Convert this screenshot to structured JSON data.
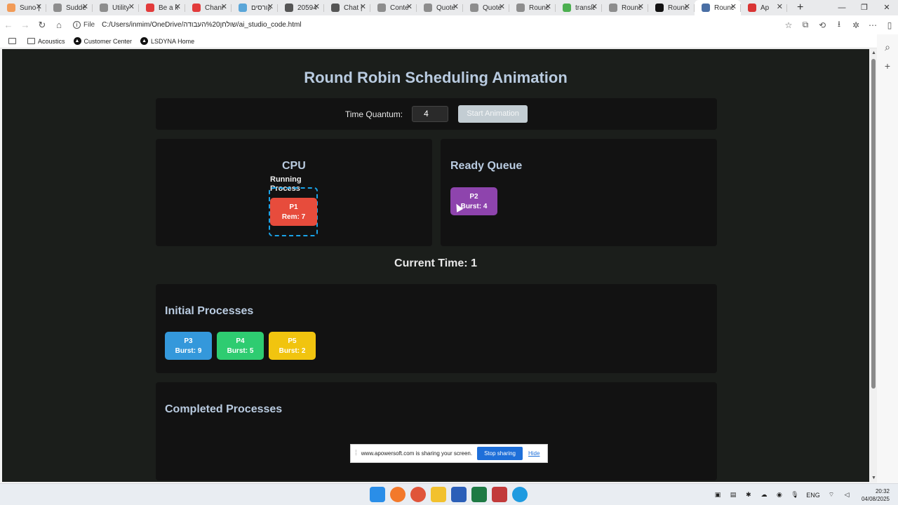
{
  "browser": {
    "tabs": [
      {
        "label": "Suno |",
        "color": "#f29b57"
      },
      {
        "label": "Sudden",
        "color": "#8d8d8d"
      },
      {
        "label": "Utility",
        "color": "#8d8d8d"
      },
      {
        "label": "Be a lo",
        "color": "#e23b3b"
      },
      {
        "label": "Chann",
        "color": "#e23b3b"
      },
      {
        "label": "קורסים",
        "color": "#5aa6d8"
      },
      {
        "label": "20594",
        "color": "#555555"
      },
      {
        "label": "Chat |",
        "color": "#555555"
      },
      {
        "label": "Conte",
        "color": "#8d8d8d"
      },
      {
        "label": "Quote",
        "color": "#8d8d8d"
      },
      {
        "label": "Quote",
        "color": "#8d8d8d"
      },
      {
        "label": "Round",
        "color": "#8d8d8d"
      },
      {
        "label": "transla",
        "color": "#4caf50"
      },
      {
        "label": "Round",
        "color": "#8d8d8d"
      },
      {
        "label": "Round",
        "color": "#111111"
      },
      {
        "label": "Round",
        "color": "#4a6fa5"
      },
      {
        "label": "Ap",
        "color": "#d93434"
      }
    ],
    "url_prefix": "File",
    "url": "C:/Users/inmim/OneDrive/שולחן%20העבודה/ai_studio_code.html",
    "bookmarks": [
      "Acoustics",
      "Customer Center",
      "LSDYNA Home"
    ]
  },
  "page": {
    "title": "Round Robin Scheduling Animation",
    "quantum_label": "Time Quantum:",
    "quantum_value": "4",
    "start_button": "Start Animation",
    "cpu_title": "CPU",
    "running_label": "Running Process",
    "running_process": {
      "name": "P1",
      "rem": "Rem: 7",
      "color": "#e74c3c"
    },
    "queue_title": "Ready Queue",
    "queue": [
      {
        "name": "P2",
        "burst": "Burst: 4",
        "color": "#8e44ad"
      }
    ],
    "current_time": "Current Time: 1",
    "initial_title": "Initial Processes",
    "initial": [
      {
        "name": "P3",
        "burst": "Burst: 9",
        "color": "#3498db"
      },
      {
        "name": "P4",
        "burst": "Burst: 5",
        "color": "#2ecc71"
      },
      {
        "name": "P5",
        "burst": "Burst: 2",
        "color": "#f1c40f"
      }
    ],
    "completed_title": "Completed Processes"
  },
  "share_bar": {
    "text": "www.apowersoft.com is sharing your screen.",
    "stop": "Stop sharing",
    "hide": "Hide"
  },
  "taskbar": {
    "lang": "ENG",
    "time": "20:32",
    "date": "04/08/2025"
  }
}
